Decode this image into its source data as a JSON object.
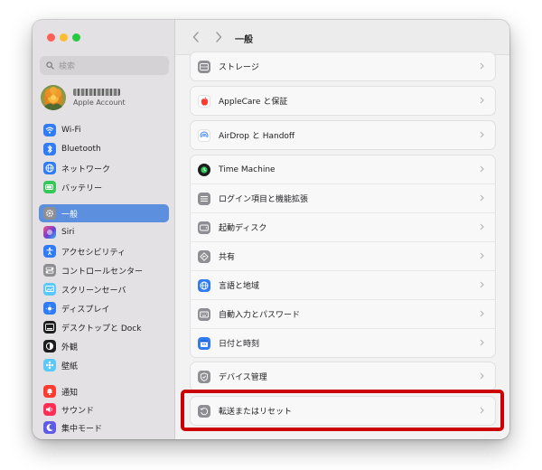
{
  "sidebar": {
    "search_placeholder": "検索",
    "account": {
      "name_blurred": "",
      "subtitle": "Apple Account"
    },
    "items": [
      {
        "label": "Wi-Fi",
        "icon": "wifi-icon",
        "color": "#2f7cf6"
      },
      {
        "label": "Bluetooth",
        "icon": "bluetooth-icon",
        "color": "#2f7cf6"
      },
      {
        "label": "ネットワーク",
        "icon": "globe-icon",
        "color": "#2f7cf6"
      },
      {
        "label": "バッテリー",
        "icon": "battery-icon",
        "color": "#34c759"
      },
      {
        "label": "一般",
        "icon": "gear-icon",
        "color": "#8e8e93",
        "selected": true
      },
      {
        "label": "Siri",
        "icon": "siri-icon",
        "color": "#6b3fd0"
      },
      {
        "label": "アクセシビリティ",
        "icon": "accessibility-icon",
        "color": "#2f7cf6"
      },
      {
        "label": "コントロールセンター",
        "icon": "control-center-icon",
        "color": "#8e8e93"
      },
      {
        "label": "スクリーンセーバ",
        "icon": "screensaver-icon",
        "color": "#5ac8fa"
      },
      {
        "label": "ディスプレイ",
        "icon": "display-icon",
        "color": "#2f7cf6"
      },
      {
        "label": "デスクトップと Dock",
        "icon": "dock-icon",
        "color": "#1d1d1f"
      },
      {
        "label": "外観",
        "icon": "appearance-icon",
        "color": "#1d1d1f"
      },
      {
        "label": "壁紙",
        "icon": "wallpaper-icon",
        "color": "#5ac8fa"
      },
      {
        "label": "通知",
        "icon": "notifications-icon",
        "color": "#ff3b30"
      },
      {
        "label": "サウンド",
        "icon": "sound-icon",
        "color": "#ff2d55"
      },
      {
        "label": "集中モード",
        "icon": "focus-icon",
        "color": "#5e5ce6"
      }
    ]
  },
  "header": {
    "title": "一般",
    "back_icon": "chevron-left-icon",
    "forward_icon": "chevron-right-icon"
  },
  "main": {
    "groups": [
      {
        "rows": [
          {
            "label": "ストレージ",
            "icon": "storage-icon"
          }
        ]
      },
      {
        "rows": [
          {
            "label": "AppleCare と保証",
            "icon": "apple-icon"
          }
        ]
      },
      {
        "rows": [
          {
            "label": "AirDrop と Handoff",
            "icon": "airdrop-icon"
          }
        ]
      },
      {
        "rows": [
          {
            "label": "Time Machine",
            "icon": "time-machine-icon"
          },
          {
            "label": "ログイン項目と機能拡張",
            "icon": "list-icon"
          },
          {
            "label": "起動ディスク",
            "icon": "startup-disk-icon"
          },
          {
            "label": "共有",
            "icon": "sharing-icon"
          },
          {
            "label": "言語と地域",
            "icon": "globe-icon"
          },
          {
            "label": "自動入力とパスワード",
            "icon": "keyboard-icon"
          },
          {
            "label": "日付と時刻",
            "icon": "calendar-icon"
          }
        ]
      },
      {
        "rows": [
          {
            "label": "デバイス管理",
            "icon": "device-management-icon"
          }
        ]
      },
      {
        "rows": [
          {
            "label": "転送またはリセット",
            "icon": "reset-icon"
          }
        ]
      }
    ],
    "highlight_color": "#cc0000"
  }
}
